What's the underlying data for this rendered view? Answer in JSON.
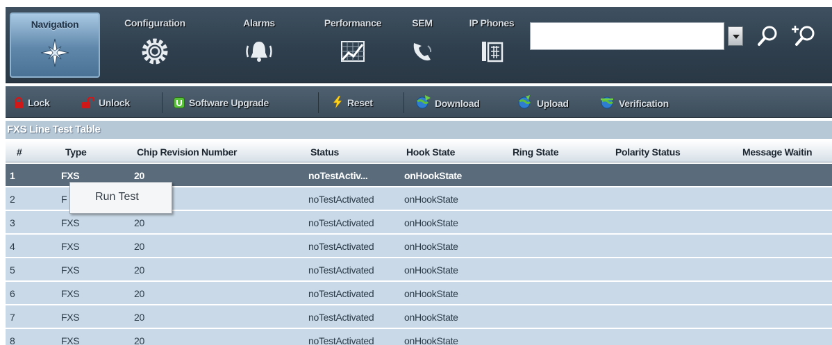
{
  "nav": {
    "tabs": [
      {
        "label": "Navigation",
        "icon": "compass-star-icon",
        "active": true
      },
      {
        "label": "Configuration",
        "icon": "gear-icon",
        "active": false
      },
      {
        "label": "Alarms",
        "icon": "bell-icon",
        "active": false
      },
      {
        "label": "Performance",
        "icon": "chart-icon",
        "active": false
      },
      {
        "label": "SEM",
        "icon": "phone-handset-icon",
        "active": false
      },
      {
        "label": "IP Phones",
        "icon": "desk-phone-icon",
        "active": false
      }
    ],
    "search": {
      "value": "",
      "placeholder": ""
    }
  },
  "toolbar": {
    "lock": "Lock",
    "unlock": "Unlock",
    "software_upgrade": "Software Upgrade",
    "reset": "Reset",
    "download": "Download",
    "upload": "Upload",
    "verification": "Verification"
  },
  "table": {
    "title": "FXS Line Test Table",
    "columns": [
      "#",
      "Type",
      "Chip Revision Number",
      "Status",
      "Hook State",
      "Ring State",
      "Polarity Status",
      "Message Waitin"
    ],
    "rows": [
      [
        "1",
        "FXS",
        "20",
        "noTestActiv...",
        "onHookState"
      ],
      [
        "2",
        "F",
        "",
        "noTestActivated",
        "onHookState"
      ],
      [
        "3",
        "FXS",
        "20",
        "noTestActivated",
        "onHookState"
      ],
      [
        "4",
        "FXS",
        "20",
        "noTestActivated",
        "onHookState"
      ],
      [
        "5",
        "FXS",
        "20",
        "noTestActivated",
        "onHookState"
      ],
      [
        "6",
        "FXS",
        "20",
        "noTestActivated",
        "onHookState"
      ],
      [
        "7",
        "FXS",
        "20",
        "noTestActivated",
        "onHookState"
      ],
      [
        "8",
        "FXS",
        "20",
        "noTestActivated",
        "onHookState"
      ]
    ],
    "selected_row": "1"
  },
  "context_menu": {
    "run_test": "Run Test"
  },
  "colors": {
    "nav_bg": "#34444f",
    "active_tab": "#6a93b8",
    "row_bg": "#c9d9e7",
    "selected_row": "#5a6c7c",
    "title_bar": "#b6c7d6"
  }
}
